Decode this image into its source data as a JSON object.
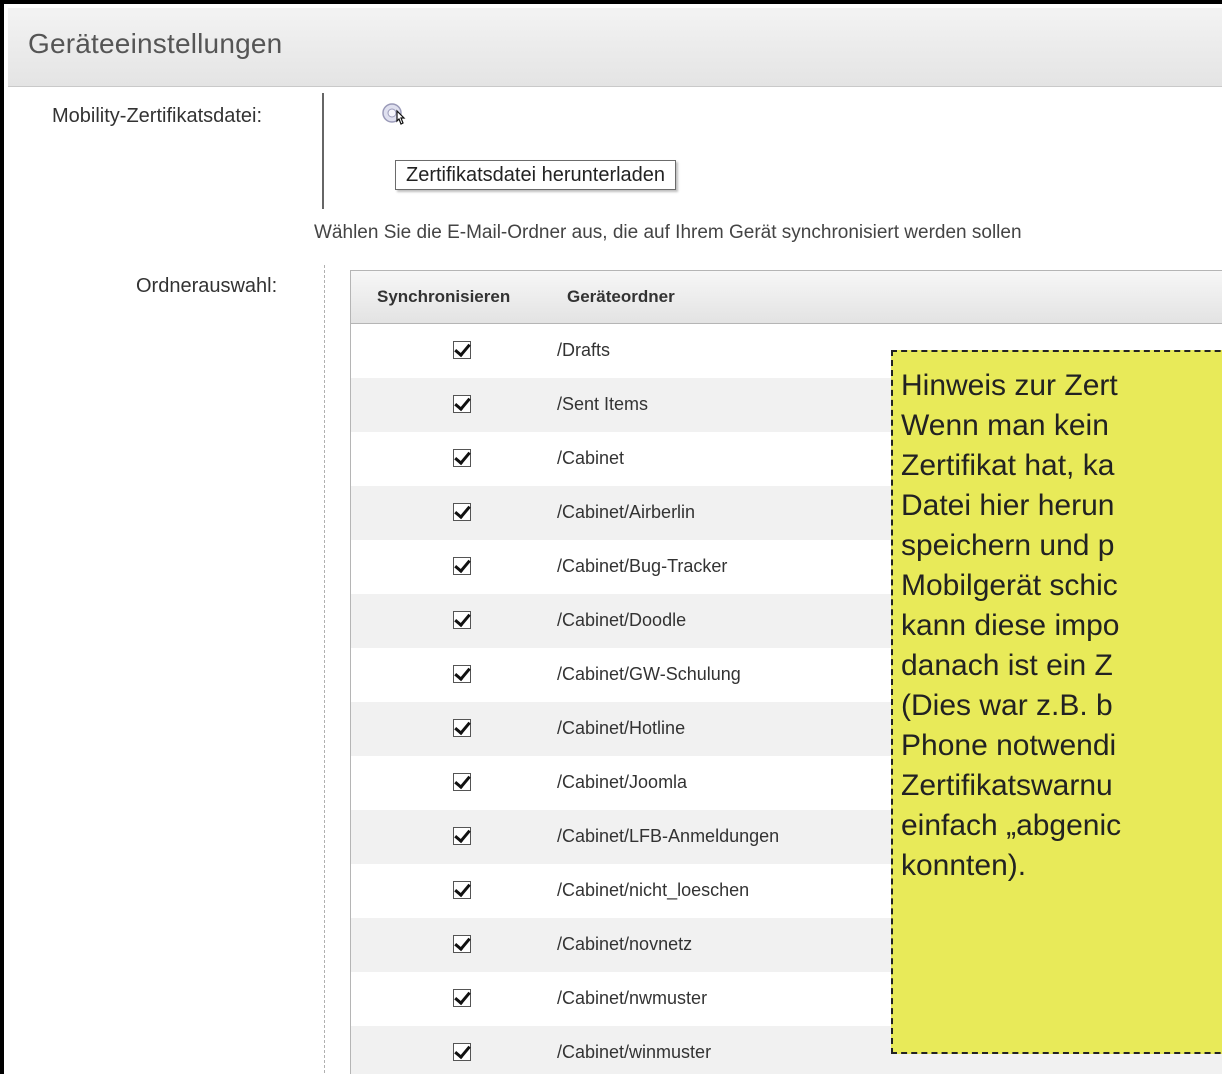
{
  "window": {
    "title": "Geräteeinstellungen"
  },
  "certificate": {
    "label": "Mobility-Zertifikatsdatei:",
    "icon": "certificate-download-icon",
    "tooltip": "Zertifikatsdatei herunterladen"
  },
  "instruction": "Wählen Sie die E-Mail-Ordner aus, die auf Ihrem Gerät synchronisiert werden sollen",
  "folders": {
    "label": "Ordnerauswahl:",
    "headers": [
      "Synchronisieren",
      "Geräteordner"
    ],
    "rows": [
      {
        "path": "/Drafts",
        "sync": true
      },
      {
        "path": "/Sent Items",
        "sync": true
      },
      {
        "path": "/Cabinet",
        "sync": true
      },
      {
        "path": "/Cabinet/Airberlin",
        "sync": true
      },
      {
        "path": "/Cabinet/Bug-Tracker",
        "sync": true
      },
      {
        "path": "/Cabinet/Doodle",
        "sync": true
      },
      {
        "path": "/Cabinet/GW-Schulung",
        "sync": true
      },
      {
        "path": "/Cabinet/Hotline",
        "sync": true
      },
      {
        "path": "/Cabinet/Joomla",
        "sync": true
      },
      {
        "path": "/Cabinet/LFB-Anmeldungen",
        "sync": true
      },
      {
        "path": "/Cabinet/nicht_loeschen",
        "sync": true
      },
      {
        "path": "/Cabinet/novnetz",
        "sync": true
      },
      {
        "path": "/Cabinet/nwmuster",
        "sync": true
      },
      {
        "path": "/Cabinet/winmuster",
        "sync": true
      }
    ]
  },
  "note": {
    "text": "Hinweis zur Zert\nWenn man kein\nZertifikat hat, ka\nDatei hier herun\nspeichern und p\nMobilgerät schic\nkann diese impo\ndanach ist ein Z\n(Dies war z.B. b\nPhone notwendi\nZertifikatswarnu\neinfach „abgenic\nkonnten).",
    "background": "#e8ea59"
  }
}
